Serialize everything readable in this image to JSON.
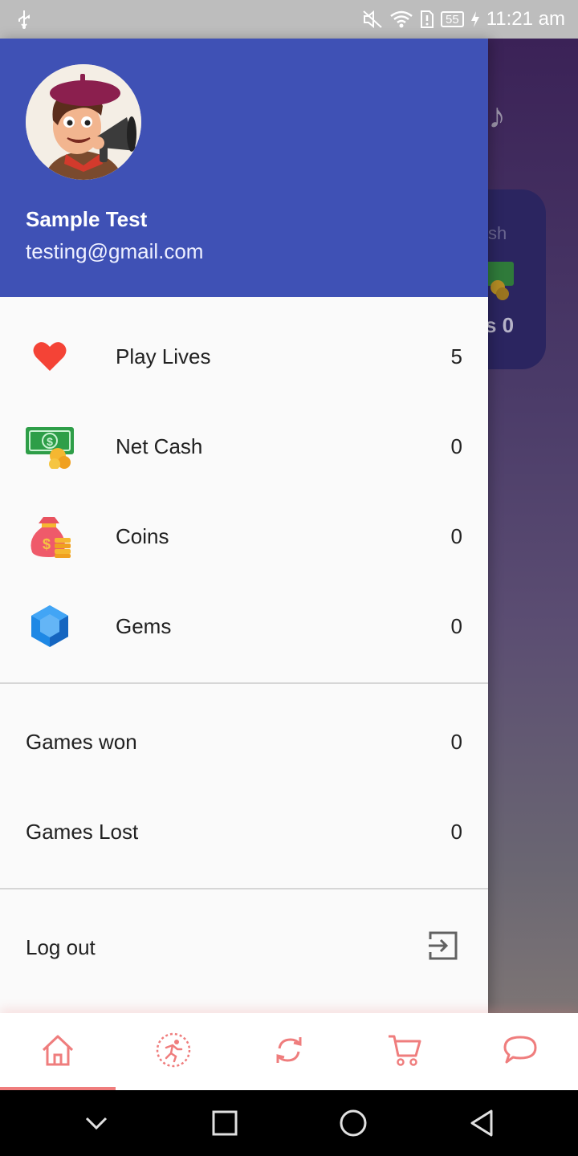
{
  "status_bar": {
    "time": "11:21 am",
    "battery": "55"
  },
  "background": {
    "card_title_fragment": "sh",
    "card_value_fragment": "s 0"
  },
  "profile": {
    "name": "Sample Test",
    "email": "testing@gmail.com"
  },
  "stats": [
    {
      "icon": "heart-icon",
      "label": "Play Lives",
      "value": "5"
    },
    {
      "icon": "cash-icon",
      "label": "Net Cash",
      "value": "0"
    },
    {
      "icon": "coin-bag-icon",
      "label": "Coins",
      "value": "0"
    },
    {
      "icon": "gem-icon",
      "label": "Gems",
      "value": "0"
    }
  ],
  "games": [
    {
      "label": "Games won",
      "value": "0"
    },
    {
      "label": "Games Lost",
      "value": "0"
    }
  ],
  "logout": {
    "label": "Log out"
  },
  "bottom_nav": [
    {
      "icon": "home-icon",
      "active": true
    },
    {
      "icon": "runner-icon",
      "active": false
    },
    {
      "icon": "refresh-icon",
      "active": false
    },
    {
      "icon": "cart-icon",
      "active": false
    },
    {
      "icon": "chat-icon",
      "active": false
    }
  ],
  "colors": {
    "header": "#3f51b5",
    "accent": "#ef7d7d",
    "status_bar": "#bdbdbd"
  }
}
